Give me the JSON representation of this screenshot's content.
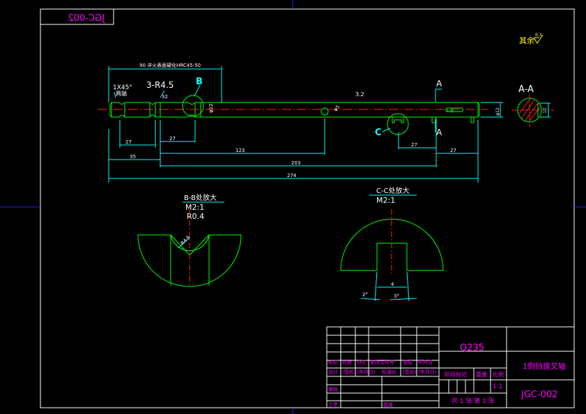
{
  "drawing_number_mirrored": "JGC-002",
  "roughness_note": "其余",
  "roughness_value": "6.3",
  "dimensions": {
    "heat_treat_note": "90 淬火表面硬化HRC45-50",
    "chamfer": "1X45°",
    "chamfer_sub": "两端",
    "groove_radius": "3-R4.5",
    "groove_sub": "32",
    "shaft_dia": "φ12",
    "hole_dia": "φ5",
    "dim_27_left": "27",
    "dim_27_mid": "27",
    "dim_35": "35",
    "dim_123": "123",
    "dim_203": "203",
    "dim_274": "274",
    "dim_27_right_a": "27",
    "dim_27_right_b": "27",
    "end_dia": "φ12",
    "keyway_note": "5 槽",
    "roughness_small": "3.2"
  },
  "section_labels": {
    "b": "B",
    "a_top": "A",
    "a_bottom": "A",
    "c": "C",
    "aa_title": "A-A",
    "aa_dim": "12"
  },
  "detail_b": {
    "title": "B-B处放大",
    "scale": "M2:1",
    "radius": "R0.4",
    "inner_radius": "R4.5"
  },
  "detail_c": {
    "title": "C-C处放大",
    "scale": "M2:1",
    "width": "4",
    "angle_left": "2°",
    "angle_right": "3°"
  },
  "title_block": {
    "material": "Q235",
    "part_name": "1倒挡拨叉轴",
    "drawing_no": "JGC-002",
    "scale_value": "1:1",
    "sheet_info": "共 1 张  第 1 张",
    "headers_row": [
      "标记",
      "处数",
      "分区",
      "更改文件号",
      "签名",
      "年月日"
    ],
    "design_row": [
      "设计",
      "(签名)",
      "(年月日)",
      "标准化",
      "(签名)",
      "(年月日)"
    ],
    "check_label": "审核",
    "process_label": "工艺",
    "approve_label": "批准",
    "stage_label": "阶段标记",
    "weight_label": "重量",
    "scale_label": "比例"
  },
  "colors": {
    "frame": "#ffffff",
    "border_line": "#2020ff",
    "part_line": "#00ff00",
    "dim_line": "#00ffff",
    "center_line": "#ff2020",
    "label": "#ff00ff",
    "note": "#ffff00"
  }
}
